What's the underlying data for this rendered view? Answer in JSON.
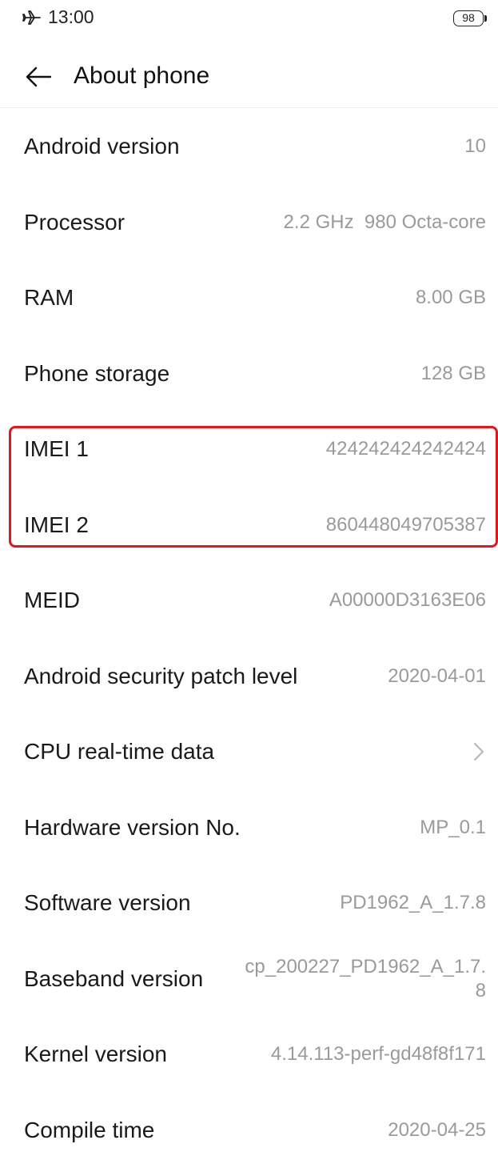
{
  "status_bar": {
    "time": "13:00",
    "battery_level": "98",
    "icons": [
      "airplane-icon",
      "battery-icon"
    ]
  },
  "app_bar": {
    "title": "About phone",
    "back_icon": "arrow-left-icon"
  },
  "rows": [
    {
      "label": "Android version",
      "value": "10"
    },
    {
      "label": "Processor",
      "value": "2.2 GHz  980 Octa-core"
    },
    {
      "label": "RAM",
      "value": "8.00 GB"
    },
    {
      "label": "Phone storage",
      "value": "128 GB"
    },
    {
      "label": "IMEI 1",
      "value": "424242424242424"
    },
    {
      "label": "IMEI 2",
      "value": "860448049705387"
    },
    {
      "label": "MEID",
      "value": "A00000D3163E06"
    },
    {
      "label": "Android security patch level",
      "value": "2020-04-01"
    },
    {
      "label": "CPU real-time data",
      "value": "",
      "icon": "chevron-right-icon"
    },
    {
      "label": "Hardware version No.",
      "value": "MP_0.1"
    },
    {
      "label": "Software version",
      "value": "PD1962_A_1.7.8"
    },
    {
      "label": "Baseband version",
      "value": "cp_200227_PD1962_A_1.7.8"
    },
    {
      "label": "Kernel version",
      "value": "4.14.113-perf-gd48f8f171"
    },
    {
      "label": "Compile time",
      "value": "2020-04-25"
    }
  ],
  "colors": {
    "highlight_border": "#e8141a",
    "value_text": "#9a9a9a",
    "label_text": "#1a1a1a"
  }
}
